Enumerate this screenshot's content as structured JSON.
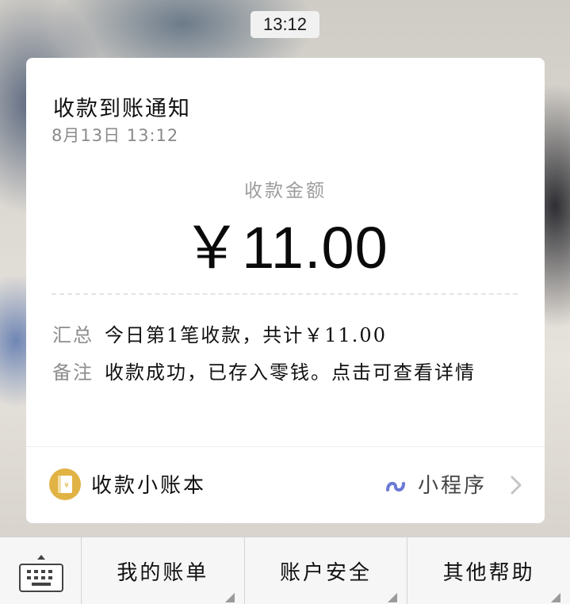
{
  "status": {
    "time": "13:12"
  },
  "card": {
    "title": "收款到账通知",
    "datetime": "8月13日  13:12",
    "amount_label": "收款金额",
    "amount": "￥11.00",
    "summary": {
      "key": "汇总",
      "value": "今日第1笔收款，共计￥11.00"
    },
    "note": {
      "key": "备注",
      "value": "收款成功，已存入零钱。点击可查看详情"
    },
    "footer": {
      "ledger_label": "收款小账本",
      "miniprogram_label": "小程序"
    }
  },
  "bottom_menu": {
    "items": [
      {
        "label": "我的账单"
      },
      {
        "label": "账户安全"
      },
      {
        "label": "其他帮助"
      }
    ]
  },
  "colors": {
    "accent_gold": "#e1b344",
    "miniprogram_blue": "#6b79d6",
    "muted_gray": "#8d8d8d"
  },
  "icons": [
    "ledger-icon",
    "miniprogram-link-icon",
    "chevron-right-icon",
    "keyboard-icon",
    "keyboard-up-arrow-icon"
  ]
}
